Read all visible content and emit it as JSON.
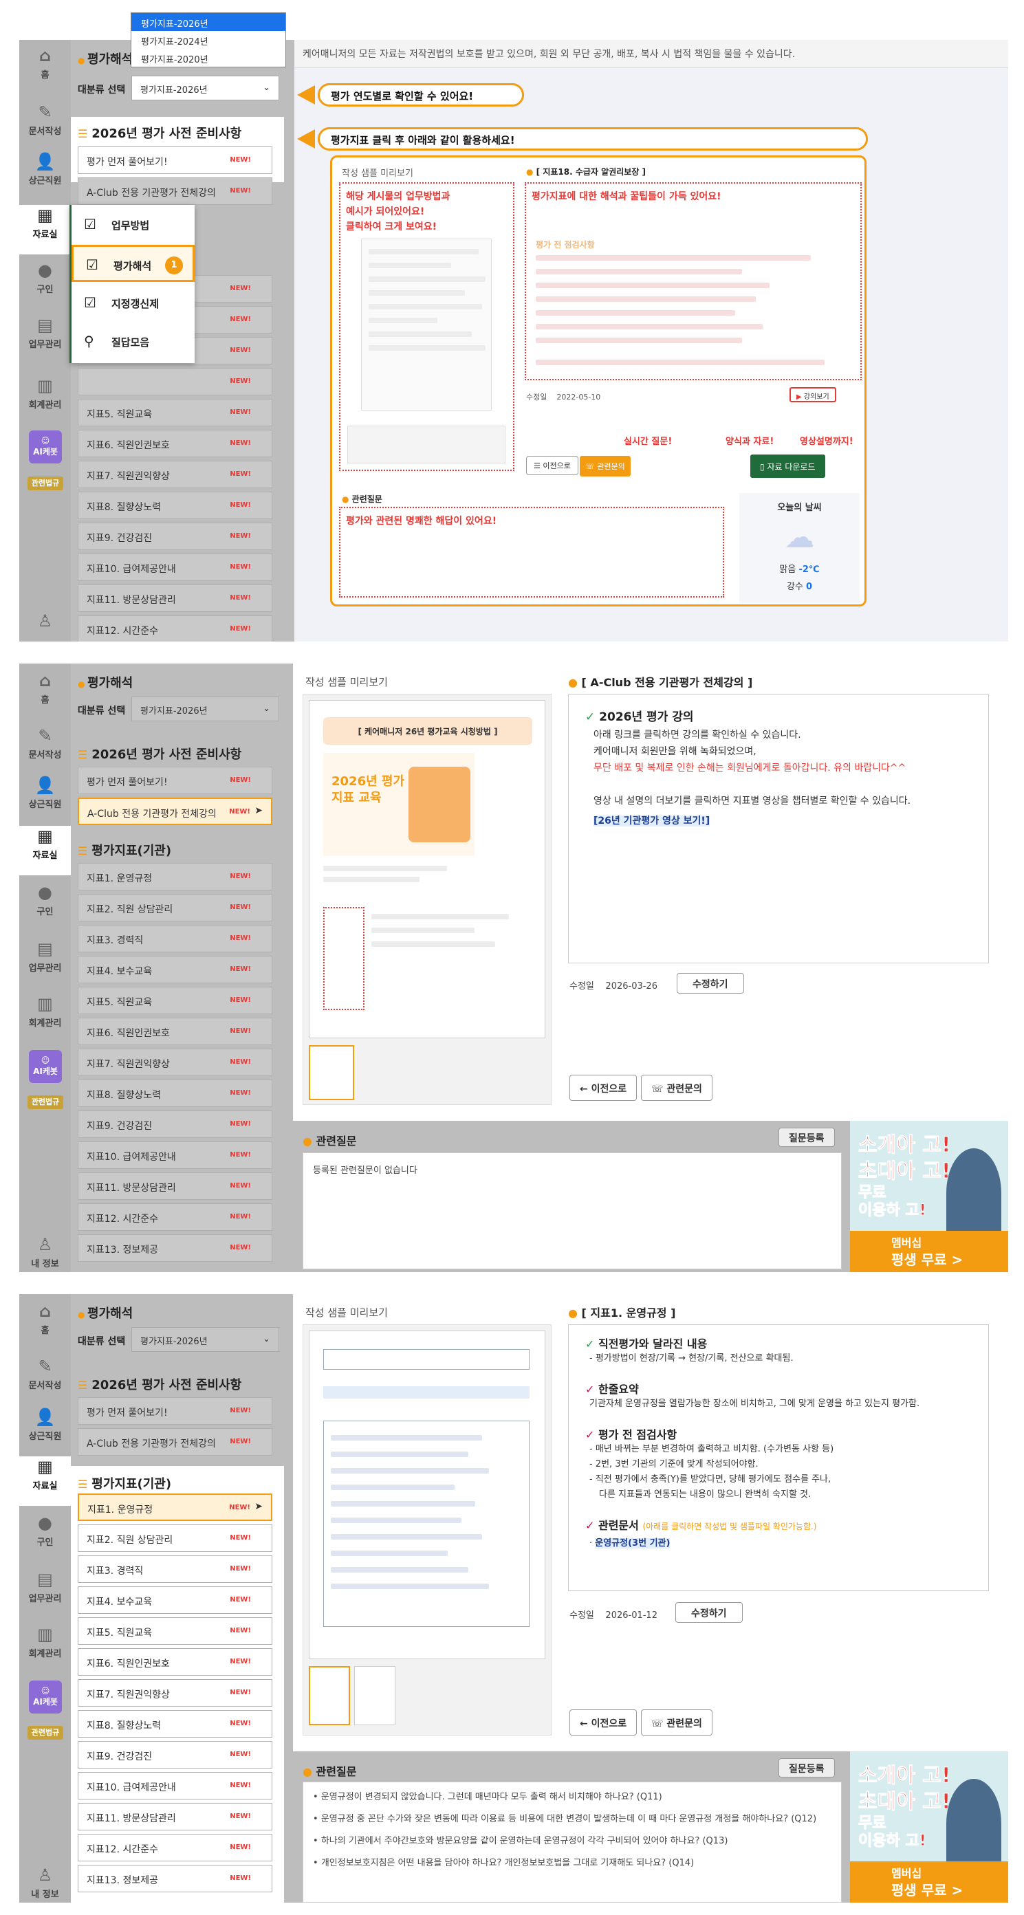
{
  "nav": {
    "home": "홈",
    "docs": "문서작성",
    "staff": "상근직원",
    "library": "자료실",
    "district": "구인",
    "work": "업무관리",
    "accounting": "회계관리",
    "ai": "AI케봇",
    "law": "관련법규",
    "myinfo": "내 정보"
  },
  "sidebar": {
    "title": "평가해석",
    "select_label": "대분류 선택",
    "select_value": "평가지표-2026년",
    "prep_title": "2026년 평가 사전 준비사항",
    "prep_items": [
      "평가 먼저 풀어보기!",
      "A-Club 전용 기관평가 전체강의"
    ],
    "index_title": "평가지표(기관)",
    "items": [
      "지표1. 운영규정",
      "지표2. 직원 상담관리",
      "지표3. 경력직",
      "지표4. 보수교육",
      "지표5. 직원교육",
      "지표6. 직원인권보호",
      "지표7. 직원권익향상",
      "지표8. 질향상노력",
      "지표9. 건강검진",
      "지표10. 급여제공안내",
      "지표11. 방문상담관리",
      "지표12. 시간준수",
      "지표13. 정보제공"
    ],
    "new": "NEW!"
  },
  "dropdown": {
    "options": [
      "평가지표-2026년",
      "평가지표-2024년",
      "평가지표-2020년"
    ]
  },
  "flyout": {
    "items": [
      "업무방법",
      "평가해석",
      "지정갱신제",
      "질답모음"
    ],
    "badge": "1"
  },
  "panel1": {
    "notice": "케어매니저의 모든 자료는 저작권법의 보호를 받고 있으며, 회원 외 무단 공개, 배포, 복사 시 법적 책임을 물을 수 있습니다.",
    "callout1": "평가 연도별로 확인할 수 있어요!",
    "callout2": "평가지표 클릭 후 아래와 같이 활용하세요!",
    "preview_label": "작성 샘플 미리보기",
    "preview_note": [
      "해당 게시물의 업무방법과",
      "예시가 되어있어요!",
      "클릭하여 크게 보여요!"
    ],
    "doc_title": "[ 지표18. 수급자 알권리보장 ]",
    "doc_note": "평가지표에 대한 해석과 꿀팁들이 가득 있어요!",
    "doc_sub": "평가 전 점검사항",
    "updated_label": "수정일",
    "updated": "2022-05-10",
    "lecture_btn": "강의보기",
    "realtime": "실시간 질문!",
    "forms": "양식과 자료!",
    "video": "영상설명까지!",
    "prev_btn": "이전으로",
    "inquiry_btn": "관련문의",
    "download_btn": "자료 다운로드",
    "rq_title": "관련질문",
    "rq_note": "평가와 관련된 명쾌한 해답이 있어요!",
    "weather_title": "오늘의 날씨",
    "weather_desc": "맑음",
    "temp": "-2℃",
    "rain_label": "강수",
    "rain": "0"
  },
  "panel2": {
    "preview_label": "작성 샘플 미리보기",
    "doc_header": "[ 케어매니저 26년 평가교육 시청방법 ]",
    "doc_banner": "2026년 평가지표 교육",
    "title": "[ A-Club 전용 기관평가 전체강의 ]",
    "h1": "2026년 평가 강의",
    "p1": "아래 링크를 클릭하면 강의를 확인하실 수 있습니다.",
    "p2": "케어매니저 회원만을 위해 녹화되었으며,",
    "p3": "무단 배포 및 복제로 인한 손해는 회원님에게로 돌아갑니다. 유의 바랍니다^^",
    "p4": "영상 내 설명의 더보기를 클릭하면 지표별 영상을 챕터별로 확인할 수 있습니다.",
    "link": "[26년 기관평가 영상 보기!]",
    "updated_label": "수정일",
    "updated": "2026-03-26",
    "edit_btn": "수정하기",
    "prev_btn": "이전으로",
    "inquiry_btn": "관련문의",
    "rq_title": "관련질문",
    "rq_btn": "질문등록",
    "rq_empty": "등록된 관련질문이 없습니다"
  },
  "panel3": {
    "preview_label": "작성 샘플 미리보기",
    "title": "[ 지표1. 운영규정 ]",
    "h1": "직전평가와 달라진 내용",
    "p1": "- 평가방법이 현장/기록 → 현장/기록, 전산으로 확대됨.",
    "h2": "한줄요약",
    "p2": "기관자체 운영규정을 열람가능한 장소에 비치하고, 그에 맞게 운영을 하고 있는지 평가함.",
    "h3": "평가 전 점검사항",
    "p3": "- 매년 바뀌는 부분 변경하여 출력하고 비치함. (수가변동 사항 등)",
    "p4": "- 2번, 3번 기관의 기준에 맞게 작성되어야함.",
    "p5": "- 직전 평가에서 충족(Y)를 받았다면, 당해 평가에도 점수를 주나,",
    "p6": "다른 지표들과 연동되는 내용이 많으니 완벽히 숙지할 것.",
    "h4": "관련문서",
    "h4note": "(아래를 클릭하면 작성법 및 샘플파일 확인가능함.)",
    "link": "운영규정(3번 기관)",
    "updated_label": "수정일",
    "updated": "2026-01-12",
    "edit_btn": "수정하기",
    "prev_btn": "이전으로",
    "inquiry_btn": "관련문의",
    "rq_title": "관련질문",
    "rq_btn": "질문등록",
    "questions": [
      "운영규정이 변경되지 않았습니다. 그런데 매년마다 모두 출력 해서 비치해야 하나요? (Q11)",
      "운영규정 중 꼰단 수가와 잦은 변동에 따라 이용료 등 비용에 대한 변경이 발생하는데 이 때 마다 운영규정 개정을 해야하나요? (Q12)",
      "하나의 기관에서 주야간보호와 방문요양을 같이 운영하는데 운영규정이 각각 구비되어 있어야 하나요? (Q13)",
      "개인정보보호지침은 어떤 내용을 담아야 하나요? 개인정보보호법을 그대로 기재해도 되나요? (Q14)"
    ]
  },
  "ad": {
    "l1": "소개아 고!",
    "l2": "초대아 고!",
    "l3": "무료",
    "l4": "이용하 고!",
    "l5": "멤버십",
    "l6": "평생 무료 >"
  },
  "colors": {
    "accent": "#f39c12",
    "alert": "#e53935",
    "download": "#1f6b3a"
  }
}
